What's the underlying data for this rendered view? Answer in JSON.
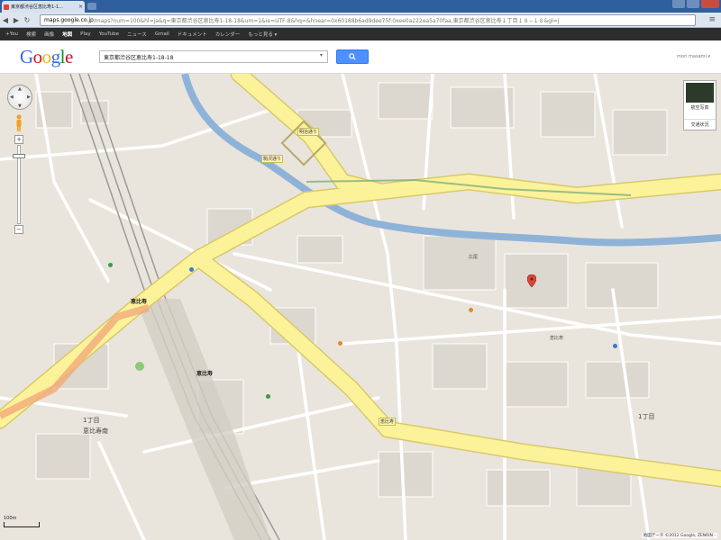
{
  "browser": {
    "tab_title": "東京都渋谷区恵比寿1-1...",
    "url_host": "maps.google.co.jp",
    "url_path": "/maps?num=100&hl=ja&q=東京都渋谷区恵比寿1-18-18&um=1&ie=UTF-8&hq=&hnear=0x60188b6ad9dee75f:0xee0a222ea5a70faa,東京都渋谷区恵比寿１丁目１８−１８&gl=j"
  },
  "gbar": {
    "items": [
      "+You",
      "検索",
      "画像",
      "地図",
      "Play",
      "YouTube",
      "ニュース",
      "Gmail",
      "ドキュメント",
      "カレンダー",
      "もっと見る ▾"
    ],
    "active_index": 3
  },
  "header": {
    "search_value": "東京都渋谷区恵比寿1-18-18",
    "user": "mori masami ▾"
  },
  "map": {
    "layers": {
      "photo_label": "航空写真",
      "traffic_label": "交通状況"
    },
    "scale": "100m",
    "copyright": "地図データ ©2012 Google, ZENRIN -",
    "pan_arrows": [
      "▲",
      "▼",
      "◀",
      "▶"
    ],
    "zoom": {
      "in": "+",
      "out": "−",
      "level_fraction": 0.12
    },
    "labels": {
      "chome_a": "1丁目",
      "area_a": "恵比寿南",
      "chome_b": "1丁目",
      "station_a": "恵比寿",
      "station_b": "恵比寿",
      "road_a": "明治通り",
      "road_b": "駒沢通り",
      "road_c": "恵比寿",
      "place_a": "広尾",
      "place_b": "恵比寿"
    },
    "colors": {
      "main_road": "#fbf29a",
      "river": "#8fb3d8",
      "pin": "#d9473a"
    }
  }
}
